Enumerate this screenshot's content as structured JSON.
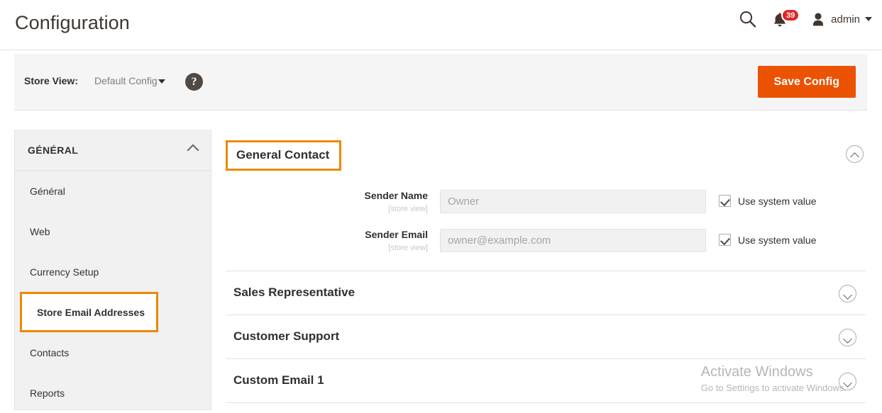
{
  "header": {
    "title": "Configuration",
    "search_icon": "search-icon",
    "notifications_icon": "bell-icon",
    "notifications_count": "39",
    "user_icon": "user-avatar-icon",
    "user_name": "admin",
    "user_caret_icon": "caret-down-icon"
  },
  "storeview": {
    "label": "Store View:",
    "value": "Default Config",
    "caret_icon": "caret-down-icon",
    "help_icon": "question-mark-icon",
    "help_glyph": "?",
    "save_label": "Save Config"
  },
  "sidebar": {
    "section_title": "GÉNÉRAL",
    "collapse_icon": "chevron-up-icon",
    "items": [
      {
        "label": "Général",
        "active": false
      },
      {
        "label": "Web",
        "active": false
      },
      {
        "label": "Currency Setup",
        "active": false
      },
      {
        "label": "Store Email Addresses",
        "active": true
      },
      {
        "label": "Contacts",
        "active": false
      },
      {
        "label": "Reports",
        "active": false
      }
    ]
  },
  "content": {
    "section_title": "General Contact",
    "section_collapse_icon": "chevron-up-circle-icon",
    "fields": [
      {
        "label": "Sender Name",
        "scope": "[store view]",
        "value": "Owner",
        "placeholder": "Owner",
        "system_value_label": "Use system value",
        "system_value_checked": true
      },
      {
        "label": "Sender Email",
        "scope": "[store view]",
        "value": "owner@example.com",
        "placeholder": "owner@example.com",
        "system_value_label": "Use system value",
        "system_value_checked": true
      }
    ],
    "collapsed_sections": [
      {
        "title": "Sales Representative",
        "icon": "chevron-down-circle-icon"
      },
      {
        "title": "Customer Support",
        "icon": "chevron-down-circle-icon"
      },
      {
        "title": "Custom Email 1",
        "icon": "chevron-down-circle-icon"
      }
    ]
  },
  "watermark": {
    "title": "Activate Windows",
    "subtitle": "Go to Settings to activate Windows."
  },
  "colors": {
    "accent_orange": "#eb5202",
    "highlight_orange": "#eb8a02",
    "badge_red": "#e22626",
    "text_dark": "#303030",
    "panel_gray": "#f1f1f1"
  }
}
